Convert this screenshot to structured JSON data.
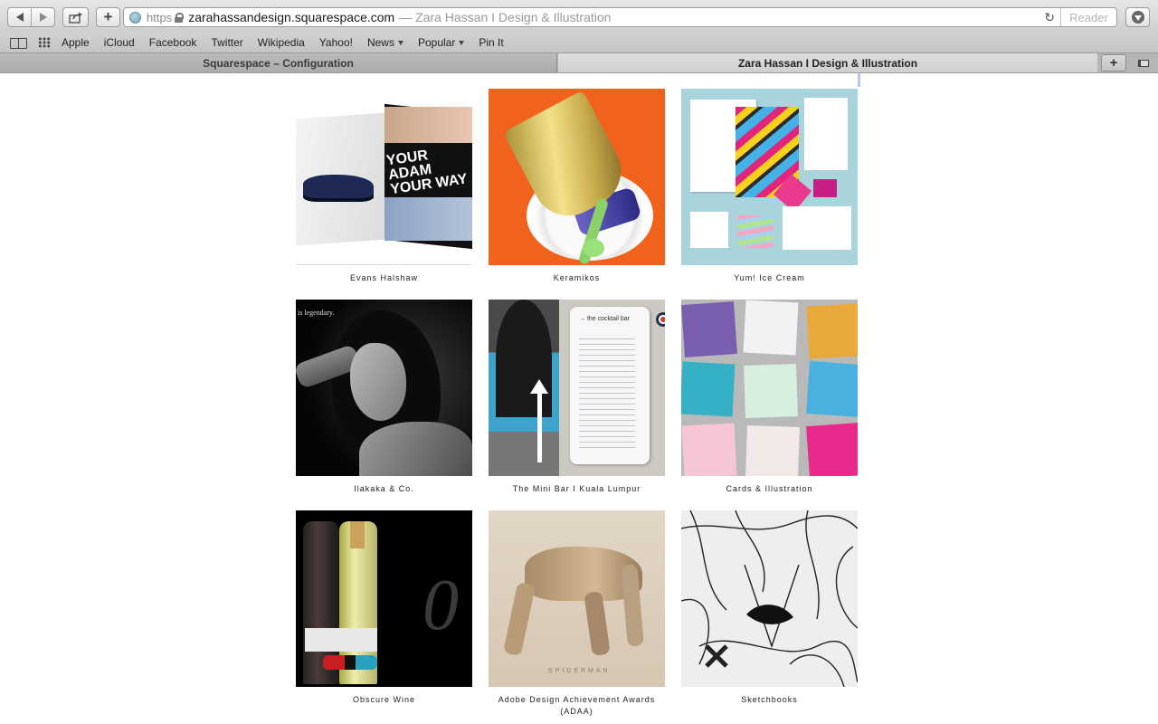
{
  "browser": {
    "url_scheme": "https",
    "url_domain": "zarahassandesign.squarespace.com",
    "url_title": "— Zara Hassan I Design & Illustration",
    "reader_label": "Reader",
    "new_tab_symbol": "+",
    "tab_plus_symbol": "+",
    "reload_symbol": "↻"
  },
  "bookmarks": [
    {
      "label": "Apple"
    },
    {
      "label": "iCloud"
    },
    {
      "label": "Facebook"
    },
    {
      "label": "Twitter"
    },
    {
      "label": "Wikipedia"
    },
    {
      "label": "Yahoo!"
    },
    {
      "label": "News"
    },
    {
      "label": "Popular"
    },
    {
      "label": "Pin It"
    }
  ],
  "tabs": [
    {
      "label": "Squarespace – Configuration",
      "active": false
    },
    {
      "label": "Zara Hassan I Design & Illustration",
      "active": true
    }
  ],
  "gallery": [
    {
      "caption": "Evans Halshaw"
    },
    {
      "caption": "Keramikos"
    },
    {
      "caption": "Yum! Ice Cream"
    },
    {
      "caption": "Ilakaka & Co."
    },
    {
      "caption": "The Mini Bar I Kuala Lumpur"
    },
    {
      "caption": "Cards & Illustration"
    },
    {
      "caption": "Obscure Wine"
    },
    {
      "caption": "Adobe Design Achievement Awards (ADAA)"
    },
    {
      "caption": "Sketchbooks"
    }
  ],
  "image_text": {
    "evans_headline": "YOUR ADAM YOUR WAY",
    "ilakaka_tagline": "is legendary.",
    "minibar_menu_title": "→ the cocktail bar",
    "adaa_signature": "SPIDERMAN"
  },
  "colors": {
    "keramikos_bg": "#f1621c",
    "yum_bg": "#aad4dc",
    "accent_blue": "#3ea3cc"
  }
}
